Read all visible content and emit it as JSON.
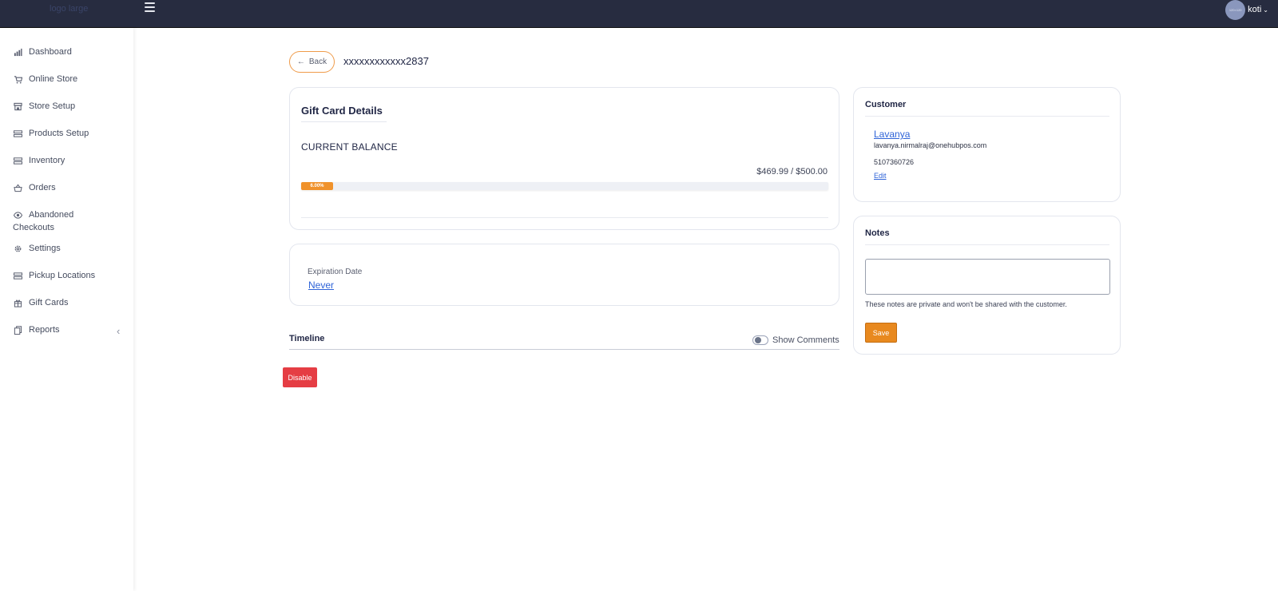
{
  "header": {
    "logo_text": "logo large",
    "user_name": "koti",
    "avatar_text": "120×120"
  },
  "sidebar": {
    "items": [
      {
        "label": "Dashboard",
        "icon": "bar-chart-icon"
      },
      {
        "label": "Online Store",
        "icon": "cart-icon"
      },
      {
        "label": "Store Setup",
        "icon": "store-icon"
      },
      {
        "label": "Products Setup",
        "icon": "server-icon"
      },
      {
        "label": "Inventory",
        "icon": "server-icon"
      },
      {
        "label": "Orders",
        "icon": "basket-icon"
      },
      {
        "label_line1": "Abandoned",
        "label_line2": "Checkouts",
        "icon": "eye-icon"
      },
      {
        "label": "Settings",
        "icon": "gear-icon"
      },
      {
        "label": "Pickup Locations",
        "icon": "server-icon"
      },
      {
        "label": "Gift Cards",
        "icon": "gift-icon"
      },
      {
        "label": "Reports",
        "icon": "report-icon"
      }
    ]
  },
  "page": {
    "back_label": "Back",
    "card_number": "xxxxxxxxxxxx2837"
  },
  "gift_card": {
    "title": "Gift Card Details",
    "current_balance_label": "CURRENT BALANCE",
    "balance_text": "$469.99 / $500.00",
    "progress_label": "6.00%",
    "progress_fraction": 0.06
  },
  "expiration": {
    "label": "Expiration Date",
    "value": "Never"
  },
  "timeline": {
    "title": "Timeline",
    "show_comments_label": "Show Comments"
  },
  "actions": {
    "disable_label": "Disable"
  },
  "customer": {
    "title": "Customer",
    "name": "Lavanya",
    "email": "lavanya.nirmalraj@onehubpos.com",
    "phone": "5107360726",
    "edit_label": "Edit"
  },
  "notes": {
    "title": "Notes",
    "value": "",
    "hint": "These notes are private and won't be shared with the customer.",
    "save_label": "Save"
  },
  "colors": {
    "topbar": "#272c40",
    "accent_orange": "#f0922b",
    "danger_red": "#e53d44",
    "link_blue": "#2f64d8"
  }
}
